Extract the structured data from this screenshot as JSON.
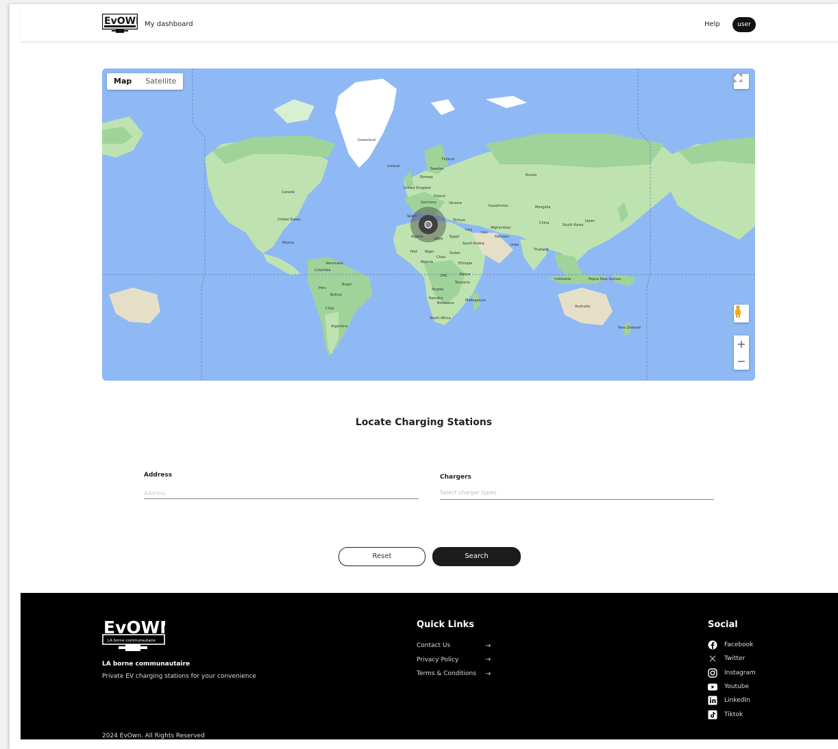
{
  "header": {
    "logo_alt": "EvOwn",
    "dashboard_label": "My dashboard",
    "help_label": "Help",
    "user_label": "user"
  },
  "map": {
    "map_type_active": "Map",
    "map_type_other": "Satellite",
    "labels": {
      "greenland": "Greenland",
      "iceland": "Iceland",
      "finland": "Finland",
      "sweden": "Sweden",
      "norway": "Norway",
      "uk": "United Kingdom",
      "poland": "Poland",
      "germany": "Germany",
      "ukraine": "Ukraine",
      "kazakhstan": "Kazakhstan",
      "mongolia": "Mongolia",
      "russia": "Russia",
      "canada": "Canada",
      "us": "United States",
      "mexico": "Mexico",
      "spain": "Spain",
      "turkiye": "Türkiye",
      "china": "China",
      "skorea": "South Korea",
      "japan": "Japan",
      "iraq": "Iraq",
      "iran": "Iran",
      "afghanistan": "Afghanistan",
      "pakistan": "Pakistan",
      "algeria": "Algeria",
      "libya": "Libya",
      "egypt": "Egypt",
      "saudi": "Saudi Arabia",
      "india": "India",
      "thailand": "Thailand",
      "mali": "Mali",
      "niger": "Niger",
      "sudan": "Sudan",
      "chad": "Chad",
      "nigeria": "Nigeria",
      "ethiopia": "Ethiopia",
      "venezuela": "Venezuela",
      "colombia": "Colombia",
      "drc": "DRC",
      "kenya": "Kenya",
      "tanzania": "Tanzania",
      "indonesia": "Indonesia",
      "png": "Papua New Guinea",
      "peru": "Peru",
      "brazil": "Brazil",
      "bolivia": "Bolivia",
      "angola": "Angola",
      "namibia": "Namibia",
      "botswana": "Botswana",
      "madagascar": "Madagascar",
      "chile": "Chile",
      "australia": "Australia",
      "south_africa": "South Africa",
      "argentina": "Argentina",
      "new_zealand": "New Zealand"
    }
  },
  "locate": {
    "title": "Locate Charging Stations",
    "address_label": "Address",
    "address_placeholder": "Address",
    "chargers_label": "Chargers",
    "chargers_placeholder": "Select charger types",
    "reset_label": "Reset",
    "search_label": "Search"
  },
  "footer": {
    "brand_name": "LA borne communautaire",
    "tagline": "Private EV charging stations for your convenience",
    "copyright": "2024 EvOwn. All Rights Reserved",
    "quick_links_title": "Quick Links",
    "quick_links": [
      {
        "label": "Contact Us"
      },
      {
        "label": "Privacy Policy"
      },
      {
        "label": "Terms & Conditions"
      }
    ],
    "arrow": "→",
    "social_title": "Social",
    "social": [
      {
        "label": "Facebook",
        "icon": "facebook-icon"
      },
      {
        "label": "Twitter",
        "icon": "x-twitter-icon"
      },
      {
        "label": "Instagram",
        "icon": "instagram-icon"
      },
      {
        "label": "Youtube",
        "icon": "youtube-icon"
      },
      {
        "label": "LinkedIn",
        "icon": "linkedin-icon"
      },
      {
        "label": "Tiktok",
        "icon": "tiktok-icon"
      }
    ]
  },
  "colors": {
    "ocean": "#8fb9f4",
    "land": "#bfe3b0",
    "forest": "#9fd39a",
    "ice": "#ffffff",
    "dark": "#111111"
  }
}
